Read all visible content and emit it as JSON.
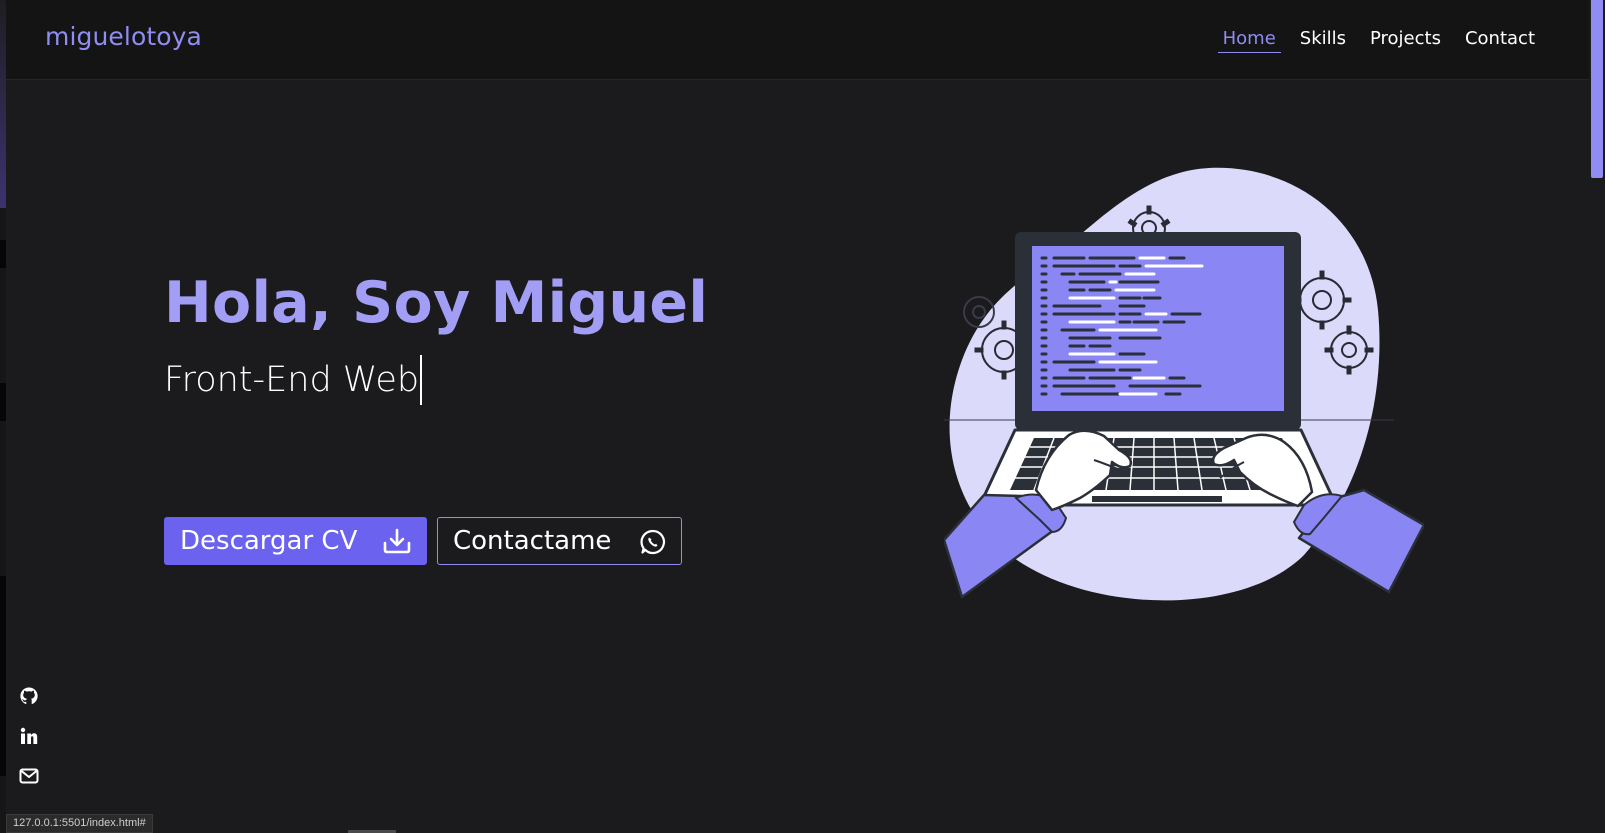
{
  "header": {
    "logo": "miguelotoya",
    "nav": [
      {
        "label": "Home",
        "active": true
      },
      {
        "label": "Skills",
        "active": false
      },
      {
        "label": "Projects",
        "active": false
      },
      {
        "label": "Contact",
        "active": false
      }
    ]
  },
  "hero": {
    "title": "Hola, Soy Miguel",
    "subtitle": "Front-End Web",
    "buttons": {
      "cv_label": "Descargar CV",
      "cv_icon": "download-icon",
      "contact_label": "Contactame",
      "contact_icon": "whatsapp-icon"
    }
  },
  "illustration": {
    "subject": "developer-laptop-illustration"
  },
  "social": [
    {
      "icon": "github-icon"
    },
    {
      "icon": "linkedin-icon"
    },
    {
      "icon": "mail-icon"
    }
  ],
  "status_bar": {
    "url": "127.0.0.1:5501/index.html#"
  },
  "colors": {
    "accent": "#8f8cf4",
    "button_bg": "#6b63ef",
    "background": "#1b1b1d",
    "header_bg": "#141414"
  }
}
